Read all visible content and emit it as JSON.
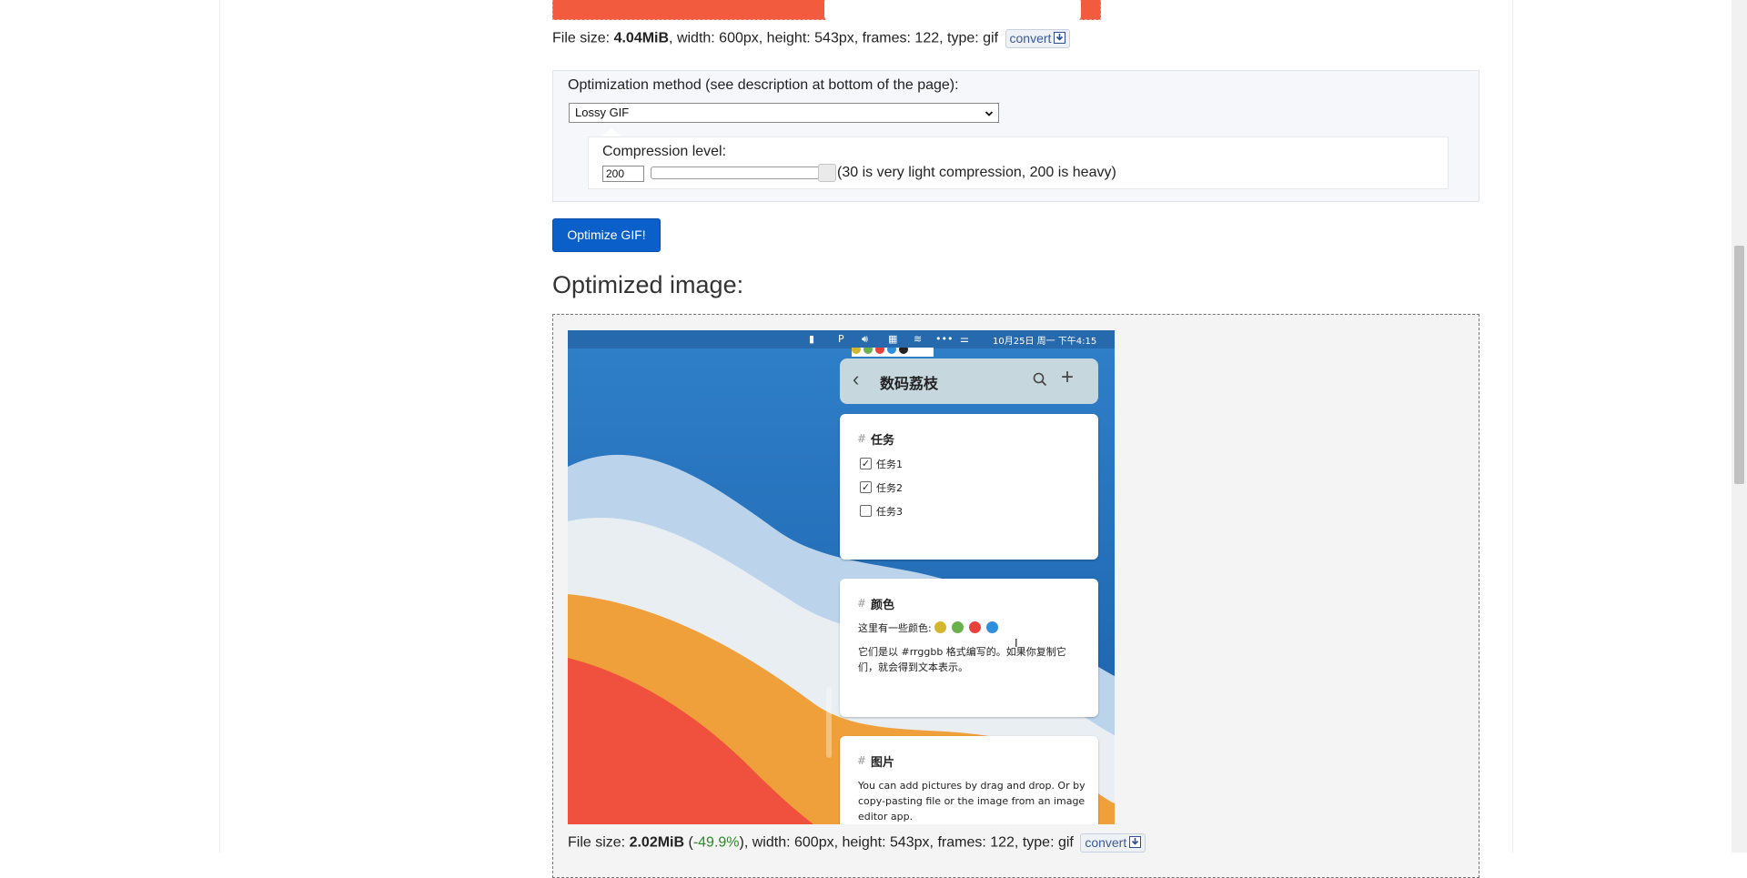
{
  "original": {
    "file_size_label": "File size: ",
    "file_size": "4.04MiB",
    "details": ", width: 600px, height: 543px, frames: 122, type: gif",
    "convert_label": "convert"
  },
  "options": {
    "method_label": "Optimization method (see description at bottom of the page):",
    "method_selected": "Lossy GIF",
    "compression_label": "Compression level:",
    "compression_value": "200",
    "compression_hint": "(30 is very light compression, 200 is heavy)",
    "compression_level_fraction": 1.0
  },
  "optimize_button": "Optimize GIF!",
  "optimized": {
    "title": "Optimized image:",
    "file_size_label": "File size: ",
    "file_size": "2.02MiB",
    "reduction": "-49.9%",
    "details": ", width: 600px, height: 543px, frames: 122, type: gif",
    "convert_label": "convert"
  },
  "gif": {
    "clock": "10月25日 周一 下午4:15",
    "app_title": "数码荔枝",
    "card_tasks": {
      "title": "任务",
      "items": [
        {
          "label": "任务1",
          "checked": true
        },
        {
          "label": "任务2",
          "checked": true
        },
        {
          "label": "任务3",
          "checked": false
        }
      ]
    },
    "card_colors": {
      "title": "颜色",
      "line1": "这里有一些颜色:",
      "line2": "它们是以 #rrggbb 格式编写的。如果你复制它",
      "line3": "们，就会得到文本表示。",
      "dots": [
        "#d4b62c",
        "#6ab04c",
        "#e8423a",
        "#2f8fdc"
      ]
    },
    "card_images": {
      "title": "图片",
      "line1": "You can add pictures by drag and drop. Or by",
      "line2": "copy-pasting file or the image from an image",
      "line3": "editor app."
    }
  }
}
